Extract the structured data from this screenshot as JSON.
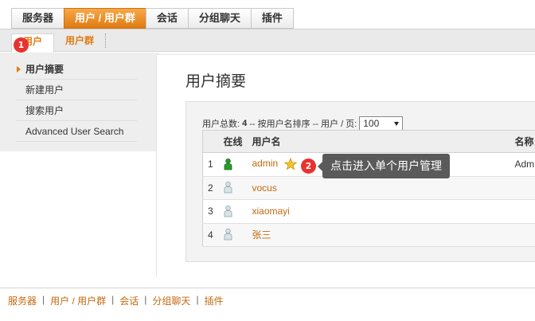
{
  "top_tabs": [
    {
      "label": "服务器",
      "active": false
    },
    {
      "label": "用户 / 用户群",
      "active": true
    },
    {
      "label": "会话",
      "active": false
    },
    {
      "label": "分组聊天",
      "active": false
    },
    {
      "label": "插件",
      "active": false
    }
  ],
  "sub_tabs": [
    {
      "label": "用户",
      "active": true
    },
    {
      "label": "用户群",
      "active": false
    }
  ],
  "sidebar": {
    "items": [
      {
        "label": "用户摘要",
        "active": true
      },
      {
        "label": "新建用户",
        "active": false
      },
      {
        "label": "搜索用户",
        "active": false
      },
      {
        "label": "Advanced User Search",
        "active": false
      }
    ]
  },
  "main": {
    "title": "用户摘要",
    "info": {
      "total_label": "用户总数:",
      "total_count": "4",
      "sort_text": "-- 按用户名排序 -- 用户 / 页:",
      "per_page": "100"
    },
    "table": {
      "headers": {
        "online": "在线",
        "username": "用户名",
        "name": "名称"
      },
      "rows": [
        {
          "num": "1",
          "online": true,
          "username": "admin",
          "name": "Adm",
          "admin": true
        },
        {
          "num": "2",
          "online": false,
          "username": "vocus",
          "name": ""
        },
        {
          "num": "3",
          "online": false,
          "username": "xiaomayi",
          "name": ""
        },
        {
          "num": "4",
          "online": false,
          "username": "张三",
          "name": ""
        }
      ]
    }
  },
  "annotations": {
    "badge1": "1",
    "badge2": "2",
    "tooltip": "点击进入单个用户管理"
  },
  "footer": {
    "links": [
      "服务器",
      "用户 / 用户群",
      "会话",
      "分组聊天",
      "插件"
    ],
    "separator": "|"
  },
  "colors": {
    "accent_orange": "#e07b12",
    "link_orange": "#c36a10",
    "badge_red": "#e8322f",
    "online_green": "#2a9a2a",
    "offline_grey": "#a8b8c0",
    "tooltip_bg": "#5a5a5a"
  }
}
